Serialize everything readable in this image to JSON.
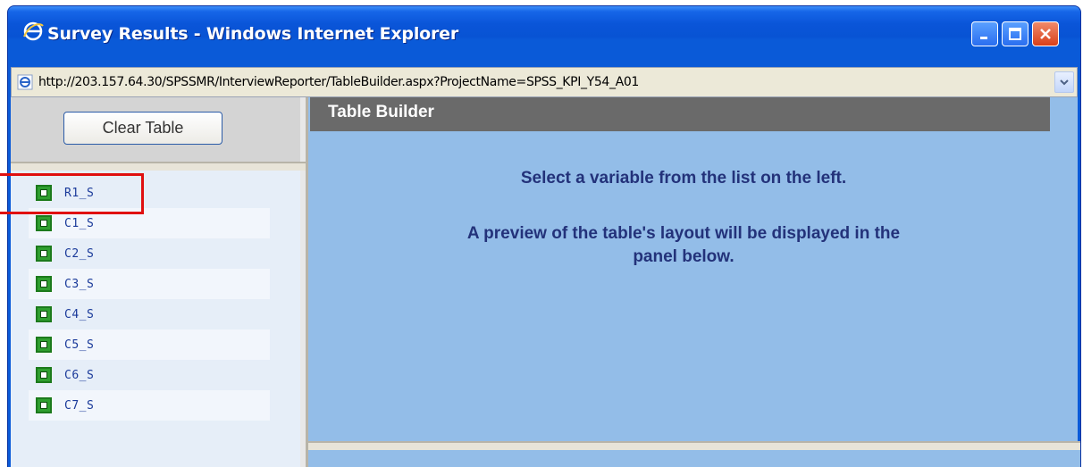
{
  "window": {
    "title": "Survey Results - Windows Internet Explorer",
    "icon": "ie-icon"
  },
  "address_bar": {
    "url": "http://203.157.64.30/SPSSMR/InterviewReporter/TableBuilder.aspx?ProjectName=SPSS_KPI_Y54_A01"
  },
  "left_panel": {
    "clear_button_label": "Clear Table",
    "variables": [
      "R1_S",
      "C1_S",
      "C2_S",
      "C3_S",
      "C4_S",
      "C5_S",
      "C6_S",
      "C7_S"
    ]
  },
  "right_panel": {
    "header": "Table Builder",
    "message_line1": "Select a variable from the list on the left.",
    "message_line2": "A preview of the table's layout will be displayed in the",
    "message_line3": "panel below."
  },
  "colors": {
    "title_bar": "#0a5ad8",
    "highlight": "#e01010",
    "panel_bg": "#93bde8",
    "header_bg": "#6a6a6a"
  }
}
